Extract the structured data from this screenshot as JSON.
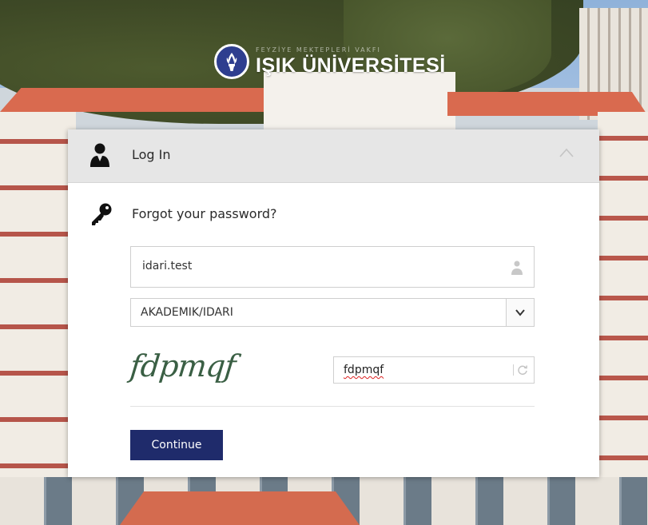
{
  "brand": {
    "tagline": "FEYZİYE MEKTEPLERİ VAKFI",
    "name": "IŞIK ÜNİVERSİTESİ"
  },
  "login": {
    "title": "Log In",
    "forgot_link": "Forgot your password?",
    "username_value": "idari.test",
    "user_type_selected": "AKADEMIK/IDARI",
    "captcha_image_text": "fdpmqf",
    "captcha_input_value": "fdpmqf",
    "continue_label": "Continue"
  },
  "colors": {
    "primary_button": "#1f2b6b",
    "panel_header": "#e6e6e6",
    "captcha_text": "#3a5f44"
  },
  "icons": {
    "header": "user-icon",
    "forgot": "key-icon",
    "username_field": "person-icon",
    "select_caret": "chevron-down-icon",
    "captcha_refresh": "refresh-icon",
    "collapse": "chevron-up-icon"
  }
}
